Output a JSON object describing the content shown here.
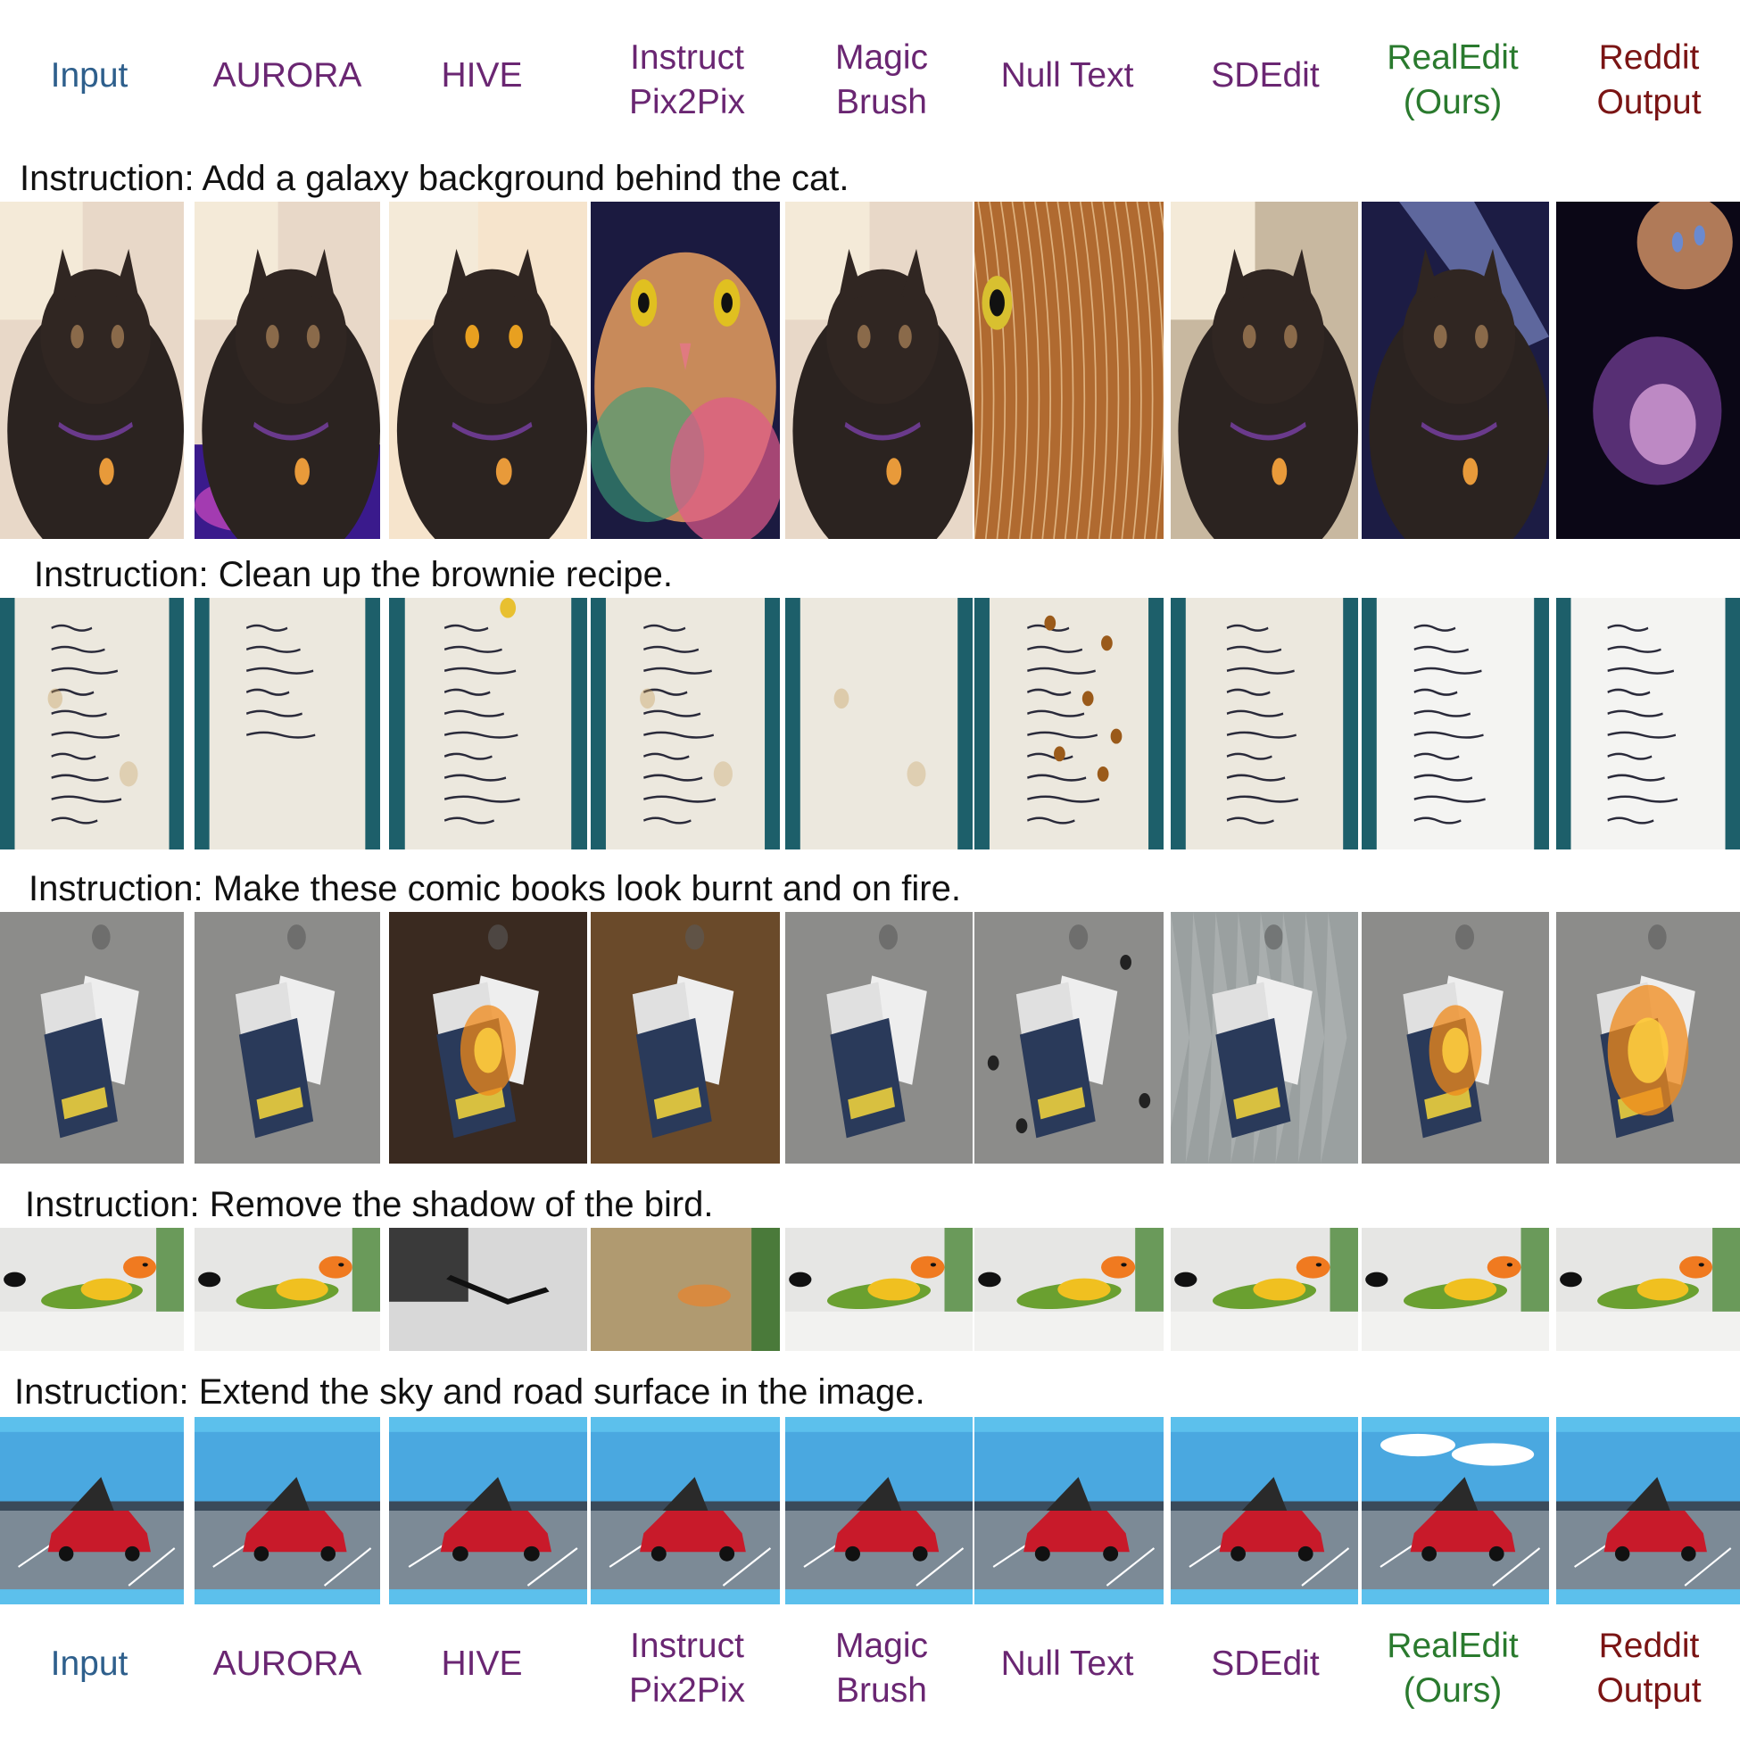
{
  "columns": [
    {
      "label": "Input",
      "color": "#2e5f8c"
    },
    {
      "label": "AURORA",
      "color": "#6a2672"
    },
    {
      "label": "HIVE",
      "color": "#6a2672"
    },
    {
      "label": "Instruct\nPix2Pix",
      "color": "#6a2672"
    },
    {
      "label": "Magic\nBrush",
      "color": "#6a2672"
    },
    {
      "label": "Null Text",
      "color": "#6a2672"
    },
    {
      "label": "SDEdit",
      "color": "#6a2672"
    },
    {
      "label": "RealEdit\n(Ours)",
      "color": "#2a7a2e"
    },
    {
      "label": "Reddit\nOutput",
      "color": "#7a1414"
    }
  ],
  "rows": [
    {
      "instruction": "Instruction: Add a galaxy background behind the cat.",
      "image_subject": "cat",
      "variants": [
        "photo",
        "galaxy-bottom",
        "photo-bright",
        "galaxy-face",
        "photo",
        "fur-closeup",
        "distorted",
        "galaxy-top",
        "galaxy-full"
      ]
    },
    {
      "instruction": "Instruction: Clean up the brownie recipe.",
      "image_subject": "recipe",
      "variants": [
        "stained",
        "partial",
        "rewritten",
        "stained",
        "blank",
        "spotted",
        "wavy",
        "clean",
        "clean"
      ]
    },
    {
      "instruction": "Instruction: Make these comic books look burnt and on fire.",
      "image_subject": "comics",
      "variants": [
        "plain",
        "plain",
        "burnt-dark",
        "burnt-brown",
        "plain",
        "scorched",
        "shattered",
        "fire",
        "fire-big"
      ]
    },
    {
      "instruction": "Instruction: Remove the shadow of the bird.",
      "image_subject": "bird",
      "variants": [
        "photo",
        "photo",
        "grayscale",
        "fox",
        "photo",
        "photo",
        "photo",
        "photo",
        "photo"
      ]
    },
    {
      "instruction": "Instruction: Extend the sky and road surface in the image.",
      "image_subject": "car",
      "variants": [
        "photo",
        "photo",
        "photo",
        "photo",
        "photo",
        "photo",
        "photo",
        "clouds",
        "photo"
      ]
    }
  ]
}
